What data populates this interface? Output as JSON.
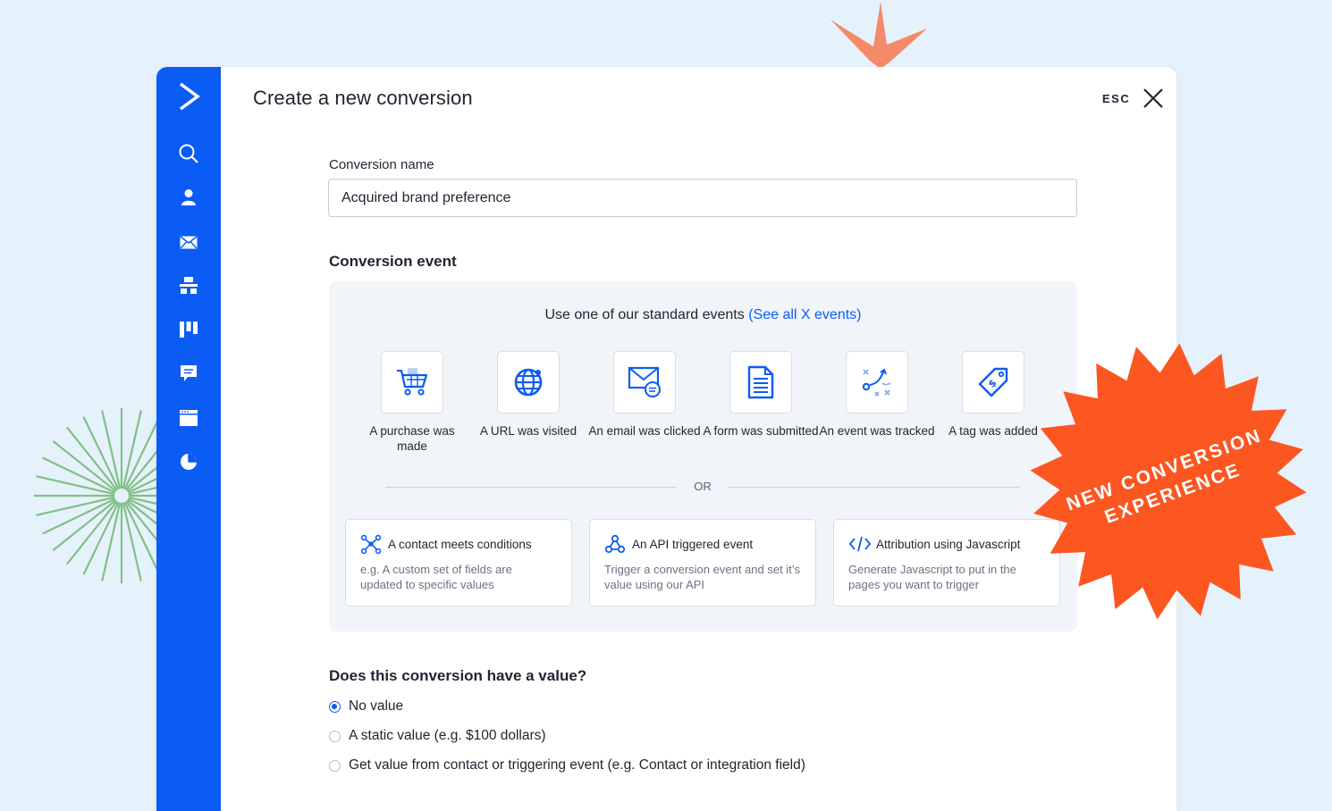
{
  "modal": {
    "title": "Create a new conversion",
    "esc_label": "ESC"
  },
  "sidebar": {
    "items": [
      {
        "icon": "logo-chevron-icon"
      },
      {
        "icon": "search-icon"
      },
      {
        "icon": "contacts-icon"
      },
      {
        "icon": "email-icon"
      },
      {
        "icon": "automations-icon"
      },
      {
        "icon": "deals-pipeline-icon"
      },
      {
        "icon": "conversations-icon"
      },
      {
        "icon": "website-icon"
      },
      {
        "icon": "reports-icon"
      }
    ]
  },
  "conversion_name": {
    "label": "Conversion name",
    "value": "Acquired brand preference"
  },
  "conversion_event": {
    "title": "Conversion event",
    "heading": "Use one of our standard events",
    "see_all_link": "(See all X events)",
    "standard_events": [
      {
        "label": "A purchase was made",
        "icon": "shopping-cart-icon"
      },
      {
        "label": "A URL was visited",
        "icon": "globe-icon"
      },
      {
        "label": "An email was clicked",
        "icon": "email-click-icon"
      },
      {
        "label": "A form was submitted",
        "icon": "form-icon"
      },
      {
        "label": "An event was tracked",
        "icon": "event-tracking-icon"
      },
      {
        "label": "A tag was added",
        "icon": "tag-icon"
      }
    ],
    "or_label": "OR",
    "custom_options": [
      {
        "title": "A contact meets conditions",
        "description": "e.g. A custom set of fields are updated to specific values",
        "icon": "network-icon"
      },
      {
        "title": "An API triggered event",
        "description": "Trigger a conversion event and set it’s value using our API",
        "icon": "webhook-icon"
      },
      {
        "title": "Attribution using Javascript",
        "description": "Generate Javascript to put in the pages you want to trigger",
        "icon": "code-icon"
      }
    ]
  },
  "value_question": {
    "title": "Does this conversion have a value?",
    "options": [
      {
        "label": "No value",
        "selected": true
      },
      {
        "label": "A static value (e.g. $100 dollars)",
        "selected": false
      },
      {
        "label": "Get value from contact or triggering event (e.g. Contact or integration field)",
        "selected": false
      }
    ]
  },
  "badge": {
    "line1": "NEW CONVERSION",
    "line2": "EXPERIENCE"
  },
  "colors": {
    "brand_blue": "#0b5cf5",
    "badge_orange": "#fc5621",
    "burst_salmon": "#f58a6a",
    "burst_green": "#82bf86",
    "page_background": "#e5f2fb"
  }
}
